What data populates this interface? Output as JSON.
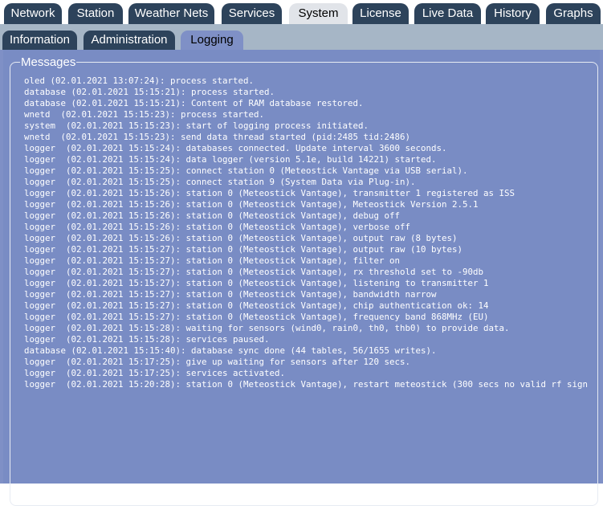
{
  "main_tabs": [
    {
      "label": "Network"
    },
    {
      "label": "Station"
    },
    {
      "label": "Weather Nets"
    },
    {
      "label": "Services"
    },
    {
      "label": "System"
    },
    {
      "label": "License"
    },
    {
      "label": "Live Data"
    },
    {
      "label": "History"
    },
    {
      "label": "Graphs"
    }
  ],
  "active_main_tab": "System",
  "sub_tabs": [
    {
      "label": "Information"
    },
    {
      "label": "Administration"
    },
    {
      "label": "Logging"
    }
  ],
  "active_sub_tab": "Logging",
  "messages": {
    "legend": "Messages",
    "lines": [
      "oled (02.01.2021 13:07:24): process started.",
      "database (02.01.2021 15:15:21): process started.",
      "database (02.01.2021 15:15:21): Content of RAM database restored.",
      "wnetd  (02.01.2021 15:15:23): process started.",
      "system  (02.01.2021 15:15:23): start of logging process initiated.",
      "wnetd  (02.01.2021 15:15:23): send data thread started (pid:2485 tid:2486)",
      "logger  (02.01.2021 15:15:24): databases connected. Update interval 3600 seconds.",
      "logger  (02.01.2021 15:15:24): data logger (version 5.1e, build 14221) started.",
      "logger  (02.01.2021 15:15:25): connect station 0 (Meteostick Vantage via USB serial).",
      "logger  (02.01.2021 15:15:25): connect station 9 (System Data via Plug-in).",
      "logger  (02.01.2021 15:15:26): station 0 (Meteostick Vantage), transmitter 1 registered as ISS",
      "logger  (02.01.2021 15:15:26): station 0 (Meteostick Vantage), Meteostick Version 2.5.1",
      "logger  (02.01.2021 15:15:26): station 0 (Meteostick Vantage), debug off",
      "logger  (02.01.2021 15:15:26): station 0 (Meteostick Vantage), verbose off",
      "logger  (02.01.2021 15:15:26): station 0 (Meteostick Vantage), output raw (8 bytes)",
      "logger  (02.01.2021 15:15:27): station 0 (Meteostick Vantage), output raw (10 bytes)",
      "logger  (02.01.2021 15:15:27): station 0 (Meteostick Vantage), filter on",
      "logger  (02.01.2021 15:15:27): station 0 (Meteostick Vantage), rx threshold set to -90db",
      "logger  (02.01.2021 15:15:27): station 0 (Meteostick Vantage), listening to transmitter 1",
      "logger  (02.01.2021 15:15:27): station 0 (Meteostick Vantage), bandwidth narrow",
      "logger  (02.01.2021 15:15:27): station 0 (Meteostick Vantage), chip authentication ok: 14",
      "logger  (02.01.2021 15:15:27): station 0 (Meteostick Vantage), frequency band 868MHz (EU)",
      "logger  (02.01.2021 15:15:28): waiting for sensors (wind0, rain0, th0, thb0) to provide data.",
      "logger  (02.01.2021 15:15:28): services paused.",
      "database (02.01.2021 15:15:40): database sync done (44 tables, 56/1655 writes).",
      "logger  (02.01.2021 15:17:25): give up waiting for sensors after 120 secs.",
      "logger  (02.01.2021 15:17:25): services activated.",
      "logger  (02.01.2021 15:20:28): station 0 (Meteostick Vantage), restart meteostick (300 secs no valid rf sign"
    ]
  },
  "colors": {
    "tab_inactive": "#2d435b",
    "tab_active": "#e1e4e9",
    "subbar": "#a6b6c6",
    "panel": "#798cc4"
  }
}
